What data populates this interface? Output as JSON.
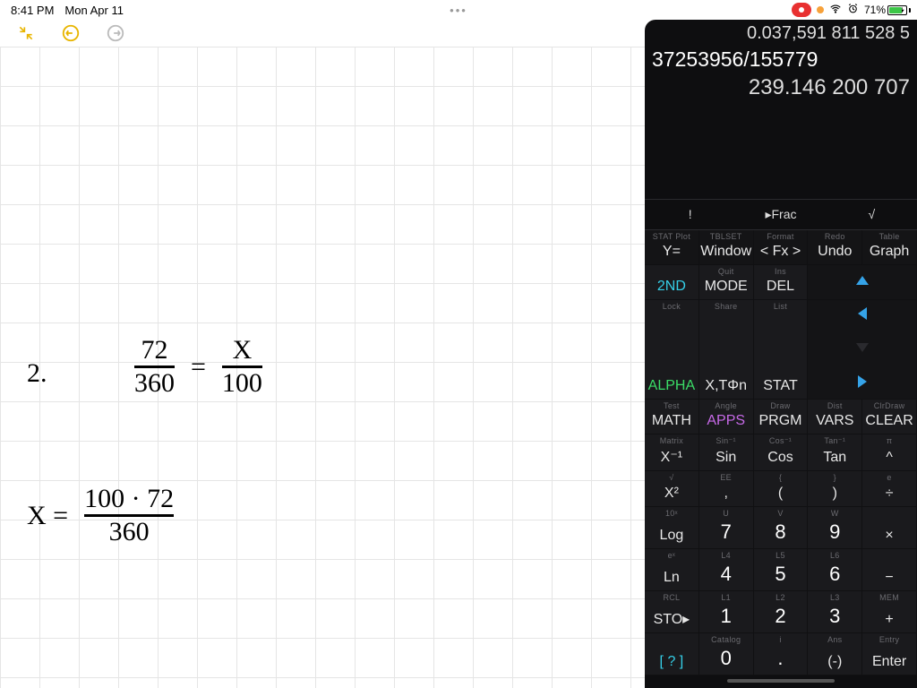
{
  "status": {
    "time": "8:41 PM",
    "date": "Mon Apr 11",
    "battery_pct": "71%"
  },
  "calc_display": {
    "line1": "0.037,591 811 528 5",
    "line2": "37253956/155779",
    "line3": "239.146 200 707"
  },
  "shortcuts": {
    "a": "!",
    "b": "▸Frac",
    "c": "√"
  },
  "keys": {
    "r1": [
      {
        "sup": "STAT Plot",
        "main": "Y="
      },
      {
        "sup": "TBLSET",
        "main": "Window"
      },
      {
        "sup": "Format",
        "main": "< Fx >"
      },
      {
        "sup": "Redo",
        "main": "Undo"
      },
      {
        "sup": "Table",
        "main": "Graph"
      }
    ],
    "r2": [
      {
        "sup": "",
        "main": "2ND",
        "cls": "cyan"
      },
      {
        "sup": "Quit",
        "main": "MODE"
      },
      {
        "sup": "Ins",
        "main": "DEL"
      }
    ],
    "r3": [
      {
        "sup": "Lock",
        "main": "ALPHA",
        "cls": "green"
      },
      {
        "sup": "Share",
        "main": "X,TΦn"
      },
      {
        "sup": "List",
        "main": "STAT"
      }
    ],
    "r4": [
      {
        "sup": "Test",
        "main": "MATH"
      },
      {
        "sup": "Angle",
        "main": "APPS",
        "cls": "purple"
      },
      {
        "sup": "Draw",
        "main": "PRGM"
      },
      {
        "sup": "Dist",
        "main": "VARS"
      },
      {
        "sup": "ClrDraw",
        "main": "CLEAR"
      }
    ],
    "r5": [
      {
        "sup": "Matrix",
        "main": "X⁻¹"
      },
      {
        "sup": "Sin⁻¹",
        "main": "Sin"
      },
      {
        "sup": "Cos⁻¹",
        "main": "Cos"
      },
      {
        "sup": "Tan⁻¹",
        "main": "Tan"
      },
      {
        "sup": "π",
        "main": "^"
      }
    ],
    "r6": [
      {
        "sup": "√",
        "main": "X²"
      },
      {
        "sup": "EE",
        "main": ","
      },
      {
        "sup": "{",
        "main": "("
      },
      {
        "sup": "}",
        "main": ")"
      },
      {
        "sup": "e",
        "main": "÷"
      }
    ],
    "r7": [
      {
        "sup": "10ˣ",
        "main": "Log"
      },
      {
        "sup": "U",
        "main": "7",
        "num": true
      },
      {
        "sup": "V",
        "main": "8",
        "num": true
      },
      {
        "sup": "W",
        "main": "9",
        "num": true
      },
      {
        "sup": "",
        "main": "×"
      }
    ],
    "r8": [
      {
        "sup": "eˣ",
        "main": "Ln"
      },
      {
        "sup": "L4",
        "main": "4",
        "num": true
      },
      {
        "sup": "L5",
        "main": "5",
        "num": true
      },
      {
        "sup": "L6",
        "main": "6",
        "num": true
      },
      {
        "sup": "",
        "main": "−"
      }
    ],
    "r9": [
      {
        "sup": "RCL",
        "main": "STO▸"
      },
      {
        "sup": "L1",
        "main": "1",
        "num": true
      },
      {
        "sup": "L2",
        "main": "2",
        "num": true
      },
      {
        "sup": "L3",
        "main": "3",
        "num": true
      },
      {
        "sup": "MEM",
        "main": "+"
      }
    ],
    "r10": [
      {
        "sup": "",
        "main": "[ ? ]",
        "cls": "cyan"
      },
      {
        "sup": "Catalog",
        "main": "0",
        "num": true
      },
      {
        "sup": "i",
        "main": ".",
        "num": true
      },
      {
        "sup": "Ans",
        "main": "(-)"
      },
      {
        "sup": "Entry",
        "main": "Enter"
      }
    ]
  },
  "handwriting": {
    "problem_num": "2.",
    "eq1_num1": "72",
    "eq1_den1": "360",
    "eq1_equals": "=",
    "eq1_num2": "X",
    "eq1_den2": "100",
    "eq2_lhs": "X =",
    "eq2_num": "100 · 72",
    "eq2_den": "360"
  }
}
